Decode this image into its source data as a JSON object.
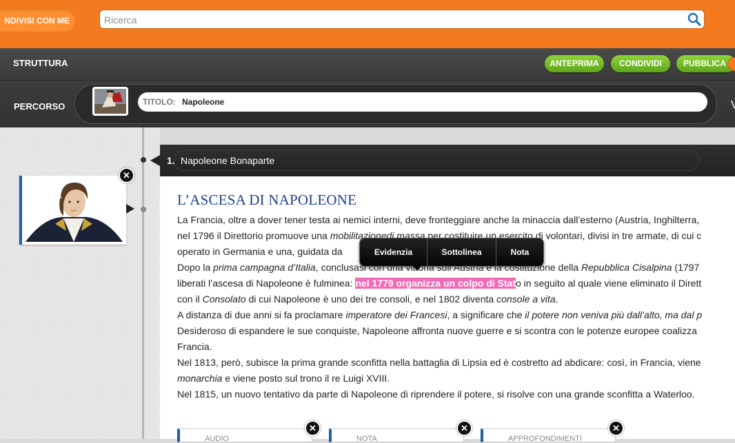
{
  "topbar": {
    "shared_label": "NDIVISI CON ME",
    "search_placeholder": "Ricerca"
  },
  "structbar": {
    "label": "STRUTTURA",
    "buttons": [
      "ANTEPRIMA",
      "CONDIVIDI",
      "PUBBLICA"
    ]
  },
  "pathbar": {
    "label": "PERCORSO",
    "title_label": "TITOLO:",
    "title_value": "Napoleone",
    "right_letter": "V"
  },
  "card": {
    "number": "1.",
    "title": "Napoleone Bonaparte",
    "heading": "L’ASCESA DI NAPOLEONE",
    "lines": [
      [
        "La Francia, oltre a dover tener testa ai nemici interni, deve fronteggiare anche la minaccia dall’esterno (Austria, Inghilterra,"
      ],
      [
        "nel 1796 il Direttorio promuove una ",
        {
          "i": "mobilitazionedi massa"
        },
        " per costituire un esercito di volontari, divisi in tre armate, di cui c"
      ],
      [
        "operato in Germania e una, guidata da "
      ],
      [
        "Dopo la ",
        {
          "i": "prima campagna d’Italia"
        },
        ", conclusasi con una vittoria sull’Austria e la costituzione della ",
        {
          "i": "Repubblica Cisalpina"
        },
        " (1797"
      ],
      [
        "liberati l’ascesa di Napoleone è fulminea: ",
        {
          "h": "nel 1779 organizza un colpo di Stat"
        },
        "o in seguito al quale viene eliminato il Dirett"
      ],
      [
        "con il ",
        {
          "i": "Consolato"
        },
        " di cui Napoleone è uno dei tre consoli, e nel 1802 diventa ",
        {
          "i": "console a vita"
        },
        "."
      ],
      [
        "A distanza di due anni si fa proclamare ",
        {
          "i": "imperatore dei Francesi"
        },
        ", a significare che ",
        {
          "i": "il potere non veniva più dall’alto, ma dal p"
        }
      ],
      [
        "Desideroso di espandere le sue conquiste, Napoleone affronta nuove guerre e si scontra con le potenze europee coalizza"
      ],
      [
        "Francia."
      ],
      [
        "Nel 1813, però, subisce la prima grande sconfitta nella battaglia di Lipsia ed è costretto ad abdicare: così, in Francia, viene"
      ],
      [
        {
          "i": "monarchia"
        },
        " e viene posto sul trono il re Luigi XVIII."
      ],
      [
        "Nel 1815, un nuovo tentativo da parte di Napoleone di riprendere il potere, si risolve con una grande sconfitta a Waterloo."
      ]
    ]
  },
  "popup": {
    "items": [
      "Evidenzia",
      "Sottolinea",
      "Nota"
    ]
  },
  "bottom_boxes": [
    "AUDIO",
    "NOTA",
    "APPROFONDIMENTI"
  ],
  "colors": {
    "topbar": "#f47a1f",
    "green_button": "#6fba24",
    "heading": "#1d3f8c",
    "highlight": "#f06ab5",
    "accent_border": "#1f5fa6"
  }
}
